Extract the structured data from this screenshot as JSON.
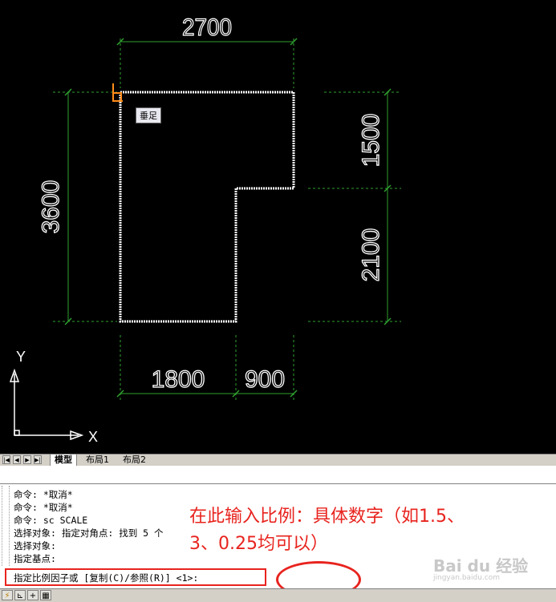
{
  "drawing": {
    "dimensions": {
      "top": "2700",
      "left": "3600",
      "right_upper": "1500",
      "right_lower": "2100",
      "bottom_left": "1800",
      "bottom_right": "900"
    },
    "osnap_tooltip": "垂足",
    "ucs": {
      "x_label": "X",
      "y_label": "Y"
    }
  },
  "tabs": {
    "nav": [
      "|◀",
      "◀",
      "▶",
      "▶|"
    ],
    "items": [
      "模型",
      "布局1",
      "布局2"
    ],
    "active": "模型"
  },
  "command_window": {
    "history": [
      "命令: *取消*",
      "命令: *取消*",
      "命令: sc SCALE",
      "选择对象: 指定对角点: 找到 5 个",
      "选择对象:",
      "指定基点:"
    ],
    "prompt": "指定比例因子或 [复制(C)/参照(R)] <1>:",
    "input_value": ""
  },
  "annotation": {
    "line1": "在此输入比例：具体数字（如1.5、",
    "line2": "3、0.25均可以）"
  },
  "status_icons": [
    "lightning-icon",
    "ortho-icon",
    "cross-icon",
    "grid-icon"
  ],
  "watermark": {
    "text": "Bai du 经验",
    "url": "jingyan.baidu.com"
  },
  "colors": {
    "accent_red": "#e8231e",
    "dimension_green": "#2fa02f",
    "osnap_orange": "#ff8c1a",
    "canvas_bg": "#000000"
  }
}
